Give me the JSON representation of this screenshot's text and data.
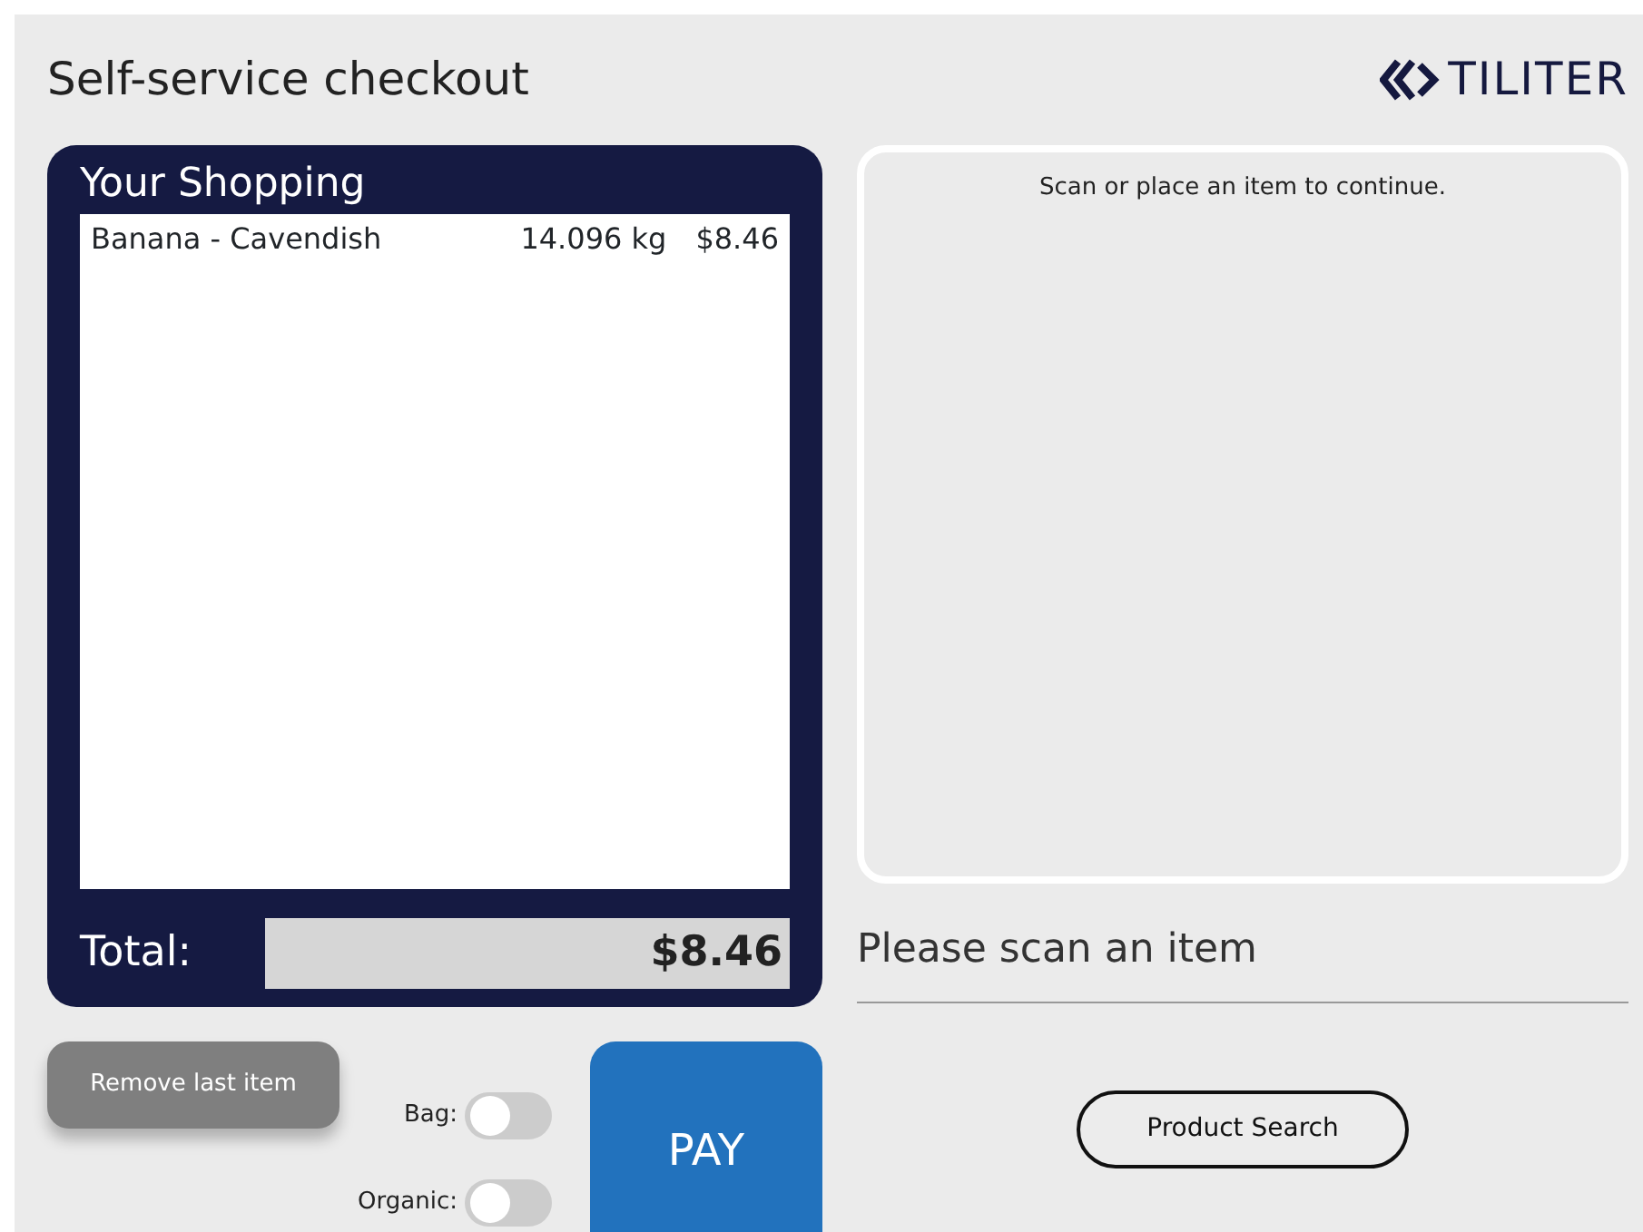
{
  "header": {
    "title": "Self-service checkout",
    "logo_text": "TILITER"
  },
  "shopping": {
    "title": "Your Shopping",
    "items": [
      {
        "name": "Banana - Cavendish",
        "weight": "14.096 kg",
        "price": "$8.46"
      }
    ],
    "total_label": "Total:",
    "total": "$8.46"
  },
  "actions": {
    "remove_button": "Remove last item",
    "toggles": [
      {
        "label": "Bag:",
        "on": false
      },
      {
        "label": "Organic:",
        "on": false
      }
    ],
    "pay_button": "PAY"
  },
  "scan_area": {
    "hint": "Scan or place an item to continue.",
    "message": "Please scan an item",
    "search_button": "Product Search"
  }
}
